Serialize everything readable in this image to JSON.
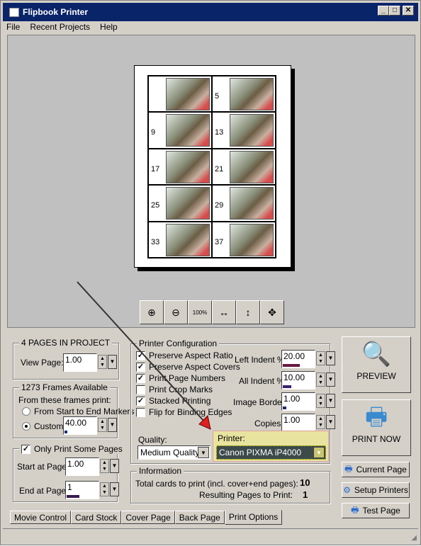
{
  "window": {
    "title": "Flipbook Printer",
    "controls": [
      "_",
      "□",
      "✕"
    ]
  },
  "menu": [
    "File",
    "Recent Projects",
    "Help"
  ],
  "preview": {
    "frames": [
      [
        "",
        "5"
      ],
      [
        "9",
        "13"
      ],
      [
        "17",
        "21"
      ],
      [
        "25",
        "29"
      ],
      [
        "33",
        "37"
      ]
    ]
  },
  "toolbar": [
    {
      "icon": "zoom-in-icon",
      "glyph": "⊕"
    },
    {
      "icon": "zoom-out-icon",
      "glyph": "⊖"
    },
    {
      "icon": "zoom-100-icon",
      "glyph": "100%"
    },
    {
      "icon": "fit-width-icon",
      "glyph": "↔"
    },
    {
      "icon": "fit-height-icon",
      "glyph": "↕"
    },
    {
      "icon": "fit-page-icon",
      "glyph": "✥"
    }
  ],
  "project": {
    "legend": "4 PAGES IN PROJECT",
    "view_page_label": "View Page:",
    "view_page": "1.00"
  },
  "frames": {
    "legend": "1273 Frames Available",
    "from_label": "From these frames print:",
    "opt_markers": "From Start to End Markers",
    "opt_custom": "Custom:",
    "custom_value": "40.00",
    "selected": "custom"
  },
  "pages": {
    "legend": "Only Print Some Pages",
    "checked": true,
    "start_label": "Start at Page:",
    "start": "1.00",
    "end_label": "End at Page:",
    "end": "1"
  },
  "config": {
    "legend": "Printer Configuration",
    "checks": [
      {
        "label": "Preserve Aspect Ratio",
        "checked": true
      },
      {
        "label": "Preserve Aspect Covers",
        "checked": true
      },
      {
        "label": "Print Page Numbers",
        "checked": true
      },
      {
        "label": "Print Crop Marks",
        "checked": false
      },
      {
        "label": "Stacked Printing",
        "checked": true
      },
      {
        "label": "Flip for Binding Edges",
        "checked": false
      }
    ],
    "left_indent_label": "Left Indent %:",
    "left_indent": "20.00",
    "all_indent_label": "All Indent %:",
    "all_indent": "10.00",
    "border_label": "Image Border:",
    "border": "1.00",
    "copies_label": "Copies:",
    "copies": "1.00",
    "quality_label": "Quality:",
    "quality": "Medium Quality",
    "printer_label": "Printer:",
    "printer": "Canon PIXMA iP4000"
  },
  "info": {
    "legend": "Information",
    "total_label": "Total cards to print (incl. cover+end pages):",
    "total": "10",
    "pages_label": "Resulting Pages to Print:",
    "pages": "1"
  },
  "buttons": {
    "preview": "PREVIEW",
    "print_now": "PRINT NOW",
    "current_page": "Current Page",
    "setup_printers": "Setup Printers",
    "test_page": "Test Page"
  },
  "tabs": [
    {
      "label": "Movie Control"
    },
    {
      "label": "Card Stock"
    },
    {
      "label": "Cover Page"
    },
    {
      "label": "Back Page"
    },
    {
      "label": "Print Options",
      "active": true
    }
  ],
  "colors": {
    "title_bar": "#0a246a",
    "printer_highlight": "#e8e4a0",
    "annotation_arrow": "#e02020"
  }
}
